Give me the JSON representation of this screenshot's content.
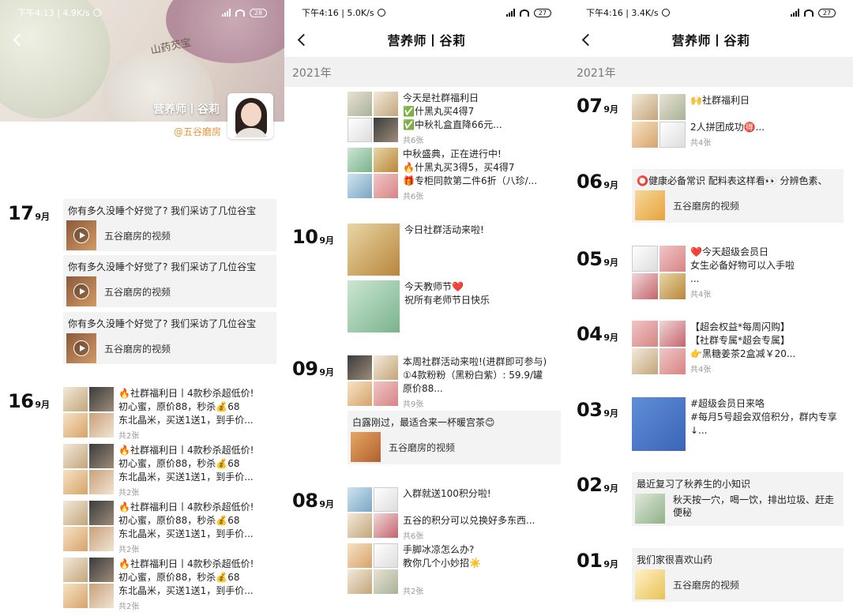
{
  "p1": {
    "status": {
      "time_speed": "下午4:13 | 4.9K/s",
      "battery": "28"
    },
    "hero": {
      "stamp": "山药芡宝",
      "name": "营养师丨谷莉",
      "subname": "@五谷磨房"
    },
    "dates": {
      "d17": {
        "day": "17",
        "month": "9月"
      },
      "d16": {
        "day": "16",
        "month": "9月"
      }
    },
    "shared": [
      {
        "title": "你有多久没睡个好觉了? 我们采访了几位谷宝",
        "label": "五谷磨房的视频"
      },
      {
        "title": "你有多久没睡个好觉了? 我们采访了几位谷宝",
        "label": "五谷磨房的视频"
      },
      {
        "title": "你有多久没睡个好觉了? 我们采访了几位谷宝",
        "label": "五谷磨房的视频"
      }
    ],
    "posts": [
      {
        "l1": "🔥社群福利日丨4款秒杀超低价!",
        "l2": "初心蜜，原价88，秒杀💰68",
        "l3": "东北晶米，买送1送1，到手价...",
        "count": "共2张"
      },
      {
        "l1": "🔥社群福利日丨4款秒杀超低价!",
        "l2": "初心蜜，原价88，秒杀💰68",
        "l3": "东北晶米，买送1送1，到手价...",
        "count": "共2张"
      },
      {
        "l1": "🔥社群福利日丨4款秒杀超低价!",
        "l2": "初心蜜，原价88，秒杀💰68",
        "l3": "东北晶米，买送1送1，到手价...",
        "count": "共2张"
      },
      {
        "l1": "🔥社群福利日丨4款秒杀超低价!",
        "l2": "初心蜜，原价88，秒杀💰68",
        "l3": "东北晶米，买送1送1，到手价...",
        "count": "共2张"
      }
    ]
  },
  "p2": {
    "status": {
      "time_speed": "下午4:16 | 5.0K/s",
      "battery": "27"
    },
    "title": "营养师丨谷莉",
    "year": "2021年",
    "dates": {
      "d10": {
        "day": "10",
        "month": "9月"
      },
      "d09": {
        "day": "09",
        "month": "9月"
      },
      "d08": {
        "day": "08",
        "month": "9月"
      }
    },
    "posts": {
      "a": {
        "l1": "今天是社群福利日",
        "l2": "✅什黑丸买4得7",
        "l3": "✅中秋礼盒直降66元...",
        "count": "共6张"
      },
      "b": {
        "l1": "中秋盛典，正在进行中!",
        "l2": "🔥什黑丸买3得5，买4得7",
        "l3": "🎁专柜同款第二件6折（八珍/...",
        "count": "共6张"
      },
      "c": {
        "l1": "今日社群活动来啦!"
      },
      "d": {
        "l1": "今天教师节❤️",
        "l2": "祝所有老师节日快乐"
      },
      "e": {
        "l1": "本周社群活动来啦!(进群即可参与)",
        "l2": "①4款粉粉（黑粉白紫）: 59.9/罐",
        "l3": "原价88...",
        "count": "共9张"
      },
      "f": {
        "title": "白露刚过，最适合来一杯暖宫茶😊",
        "label": "五谷磨房的视频"
      },
      "g": {
        "l1": "入群就送100积分啦!",
        "l2": "",
        "l3": "五谷的积分可以兑换好多东西...",
        "count": "共6张"
      },
      "h": {
        "l1": "手脚冰凉怎么办?",
        "l2": "教你几个小妙招☀️",
        "count": "共2张"
      }
    }
  },
  "p3": {
    "status": {
      "time_speed": "下午4:16 | 3.4K/s",
      "battery": "27"
    },
    "title": "营养师丨谷莉",
    "year": "2021年",
    "dates": {
      "d07": {
        "day": "07",
        "month": "9月"
      },
      "d06": {
        "day": "06",
        "month": "9月"
      },
      "d05": {
        "day": "05",
        "month": "9月"
      },
      "d04": {
        "day": "04",
        "month": "9月"
      },
      "d03": {
        "day": "03",
        "month": "9月"
      },
      "d02": {
        "day": "02",
        "month": "9月"
      },
      "d01": {
        "day": "01",
        "month": "9月"
      }
    },
    "posts": {
      "a": {
        "l1": "🙌社群福利日",
        "l2": "",
        "l3": "2人拼团成功🉐...",
        "count": "共4张"
      },
      "b": {
        "title": "⭕健康必备常识 配料表这样看👀 分辨色素、",
        "label": "五谷磨房的视频"
      },
      "c": {
        "l1": "❤️今天超级会员日",
        "l2": "女生必备好物可以入手啦",
        "l3": "...",
        "count": "共4张"
      },
      "d": {
        "l1": "【超会权益*每周闪购】",
        "l2": "【社群专属*超会专属】",
        "l3": "👉黑糖姜茶2盒减￥20...",
        "count": "共4张"
      },
      "e": {
        "l1": "#超级会员日来咯",
        "l2": "#每月5号超会双倍积分，群内专享",
        "l3": "↓..."
      },
      "f": {
        "title": "最近复习了秋养生的小知识",
        "l1": "秋天按一穴，喝一饮，排出垃圾、赶走",
        "l2": "便秘"
      },
      "g": {
        "title": "我们家很喜欢山药",
        "label": "五谷磨房的视频"
      }
    }
  }
}
